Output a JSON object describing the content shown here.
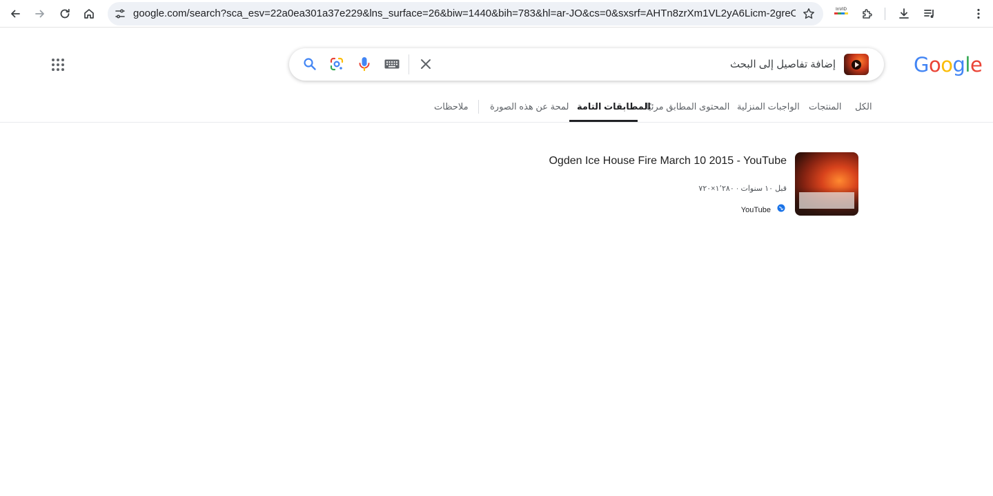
{
  "browser": {
    "url": "google.com/search?sca_esv=22a0ea301a37e229&lns_surface=26&biw=1440&bih=783&hl=ar-JO&cs=0&sxsrf=AHTn8zrXm1VL2yA6Licm-2greOzN_iynt...",
    "extension_label": "InVID"
  },
  "search": {
    "query_placeholder": "إضافة تفاصيل إلى البحث"
  },
  "logo": {
    "letters": [
      "G",
      "o",
      "o",
      "g",
      "l",
      "e"
    ],
    "colors": [
      "#4285f4",
      "#ea4335",
      "#fbbc05",
      "#4285f4",
      "#34a853",
      "#ea4335"
    ]
  },
  "tabs": [
    {
      "label": "الكل"
    },
    {
      "label": "المنتجات"
    },
    {
      "label": "الواجبات المنزلية"
    },
    {
      "label": "المحتوى المطابق مرئيًا"
    },
    {
      "label": "المطابقات التامة",
      "active": true
    },
    {
      "label": "لمحة عن هذه الصورة"
    },
    {
      "label": "ملاحظات"
    }
  ],
  "result": {
    "title": "Ogden Ice House Fire March 10 2015 - YouTube",
    "meta": "قبل ١٠ سنوات · ١٬٢٨٠×٧٢٠",
    "source": "YouTube"
  },
  "colors": {
    "accent": "#1a73e8",
    "tab_active": "#202124",
    "tab_text": "#5f6368"
  }
}
